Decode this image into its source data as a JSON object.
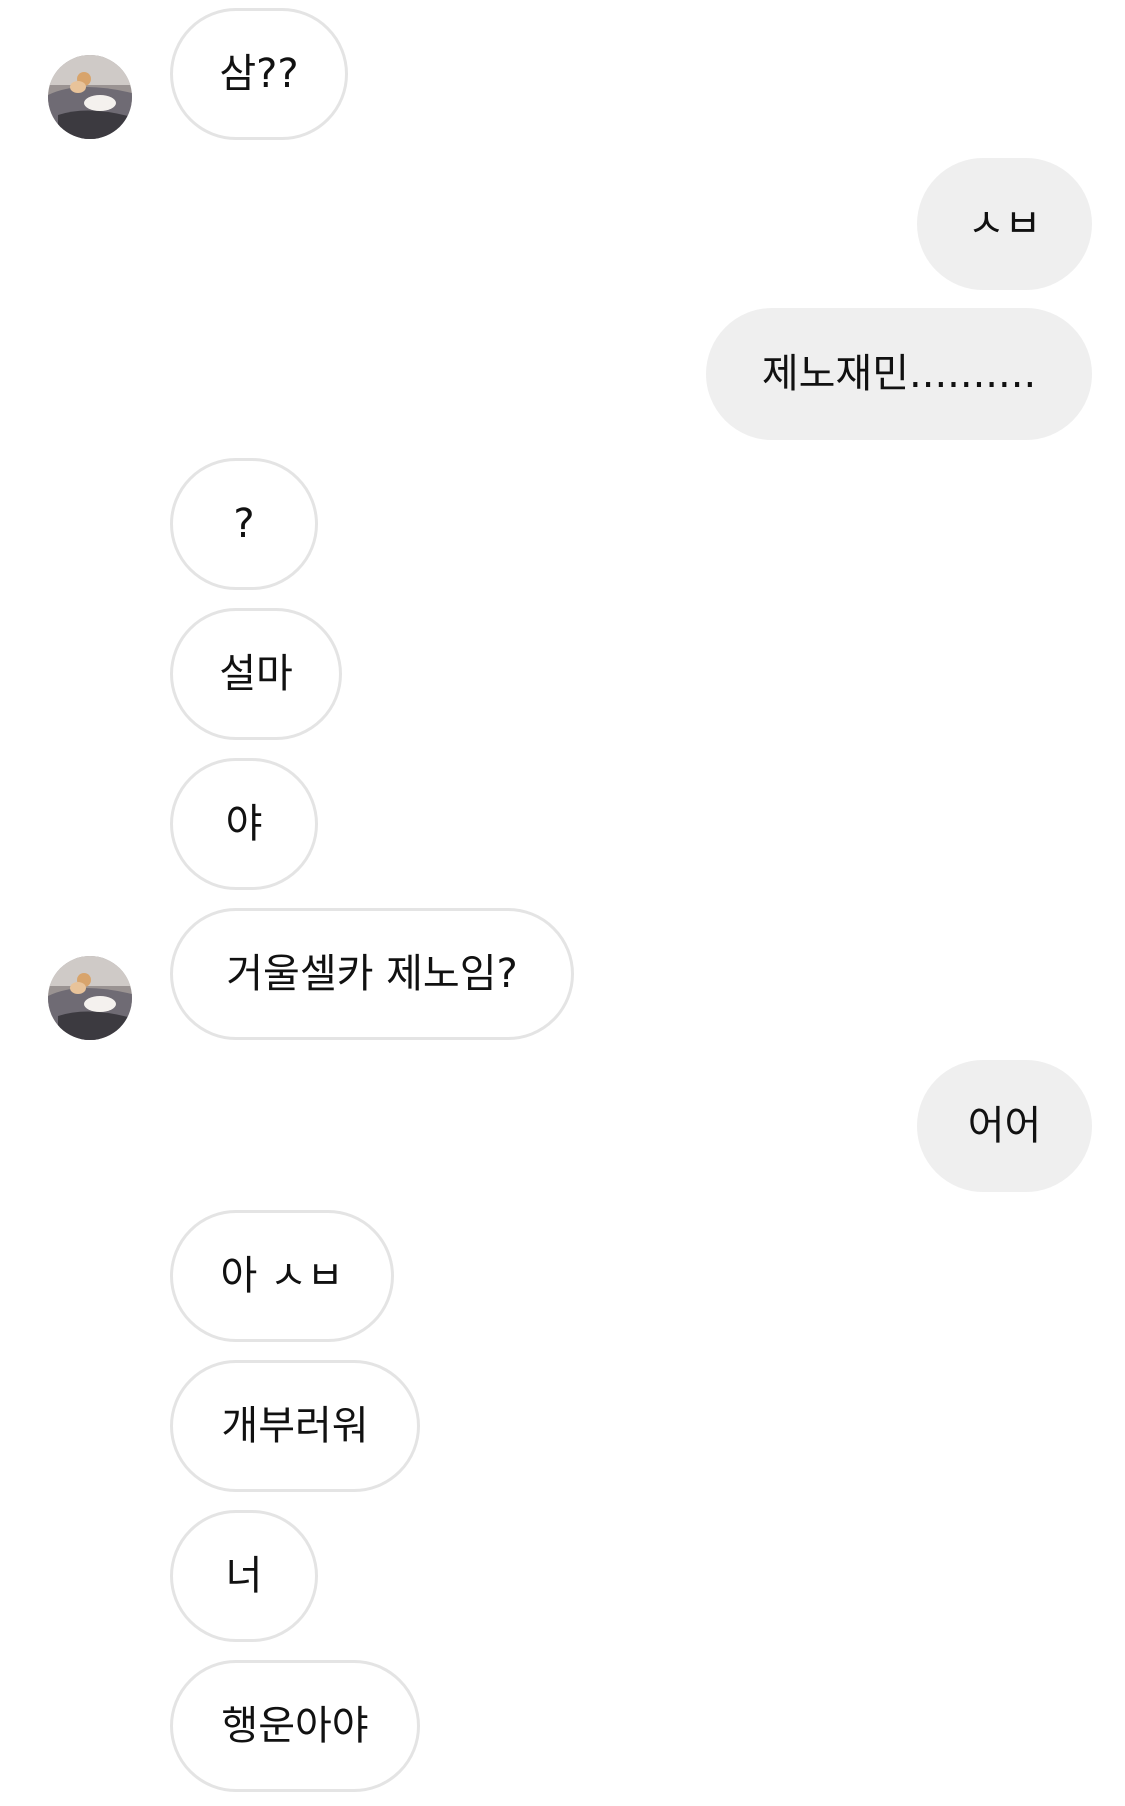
{
  "conversation": {
    "messages": [
      {
        "side": "in",
        "text": "삼??"
      },
      {
        "side": "out",
        "text": "ㅅㅂ"
      },
      {
        "side": "out",
        "text": "제노재민.........."
      },
      {
        "side": "in",
        "text": "?"
      },
      {
        "side": "in",
        "text": "설마"
      },
      {
        "side": "in",
        "text": "야"
      },
      {
        "side": "in",
        "text": "거울셀카 제노임?"
      },
      {
        "side": "out",
        "text": "어어"
      },
      {
        "side": "in",
        "text": "아 ㅅㅂ"
      },
      {
        "side": "in",
        "text": "개부러워"
      },
      {
        "side": "in",
        "text": "너"
      },
      {
        "side": "in",
        "text": "행운아야"
      }
    ],
    "avatar_icon": "cat-profile-photo-icon"
  }
}
